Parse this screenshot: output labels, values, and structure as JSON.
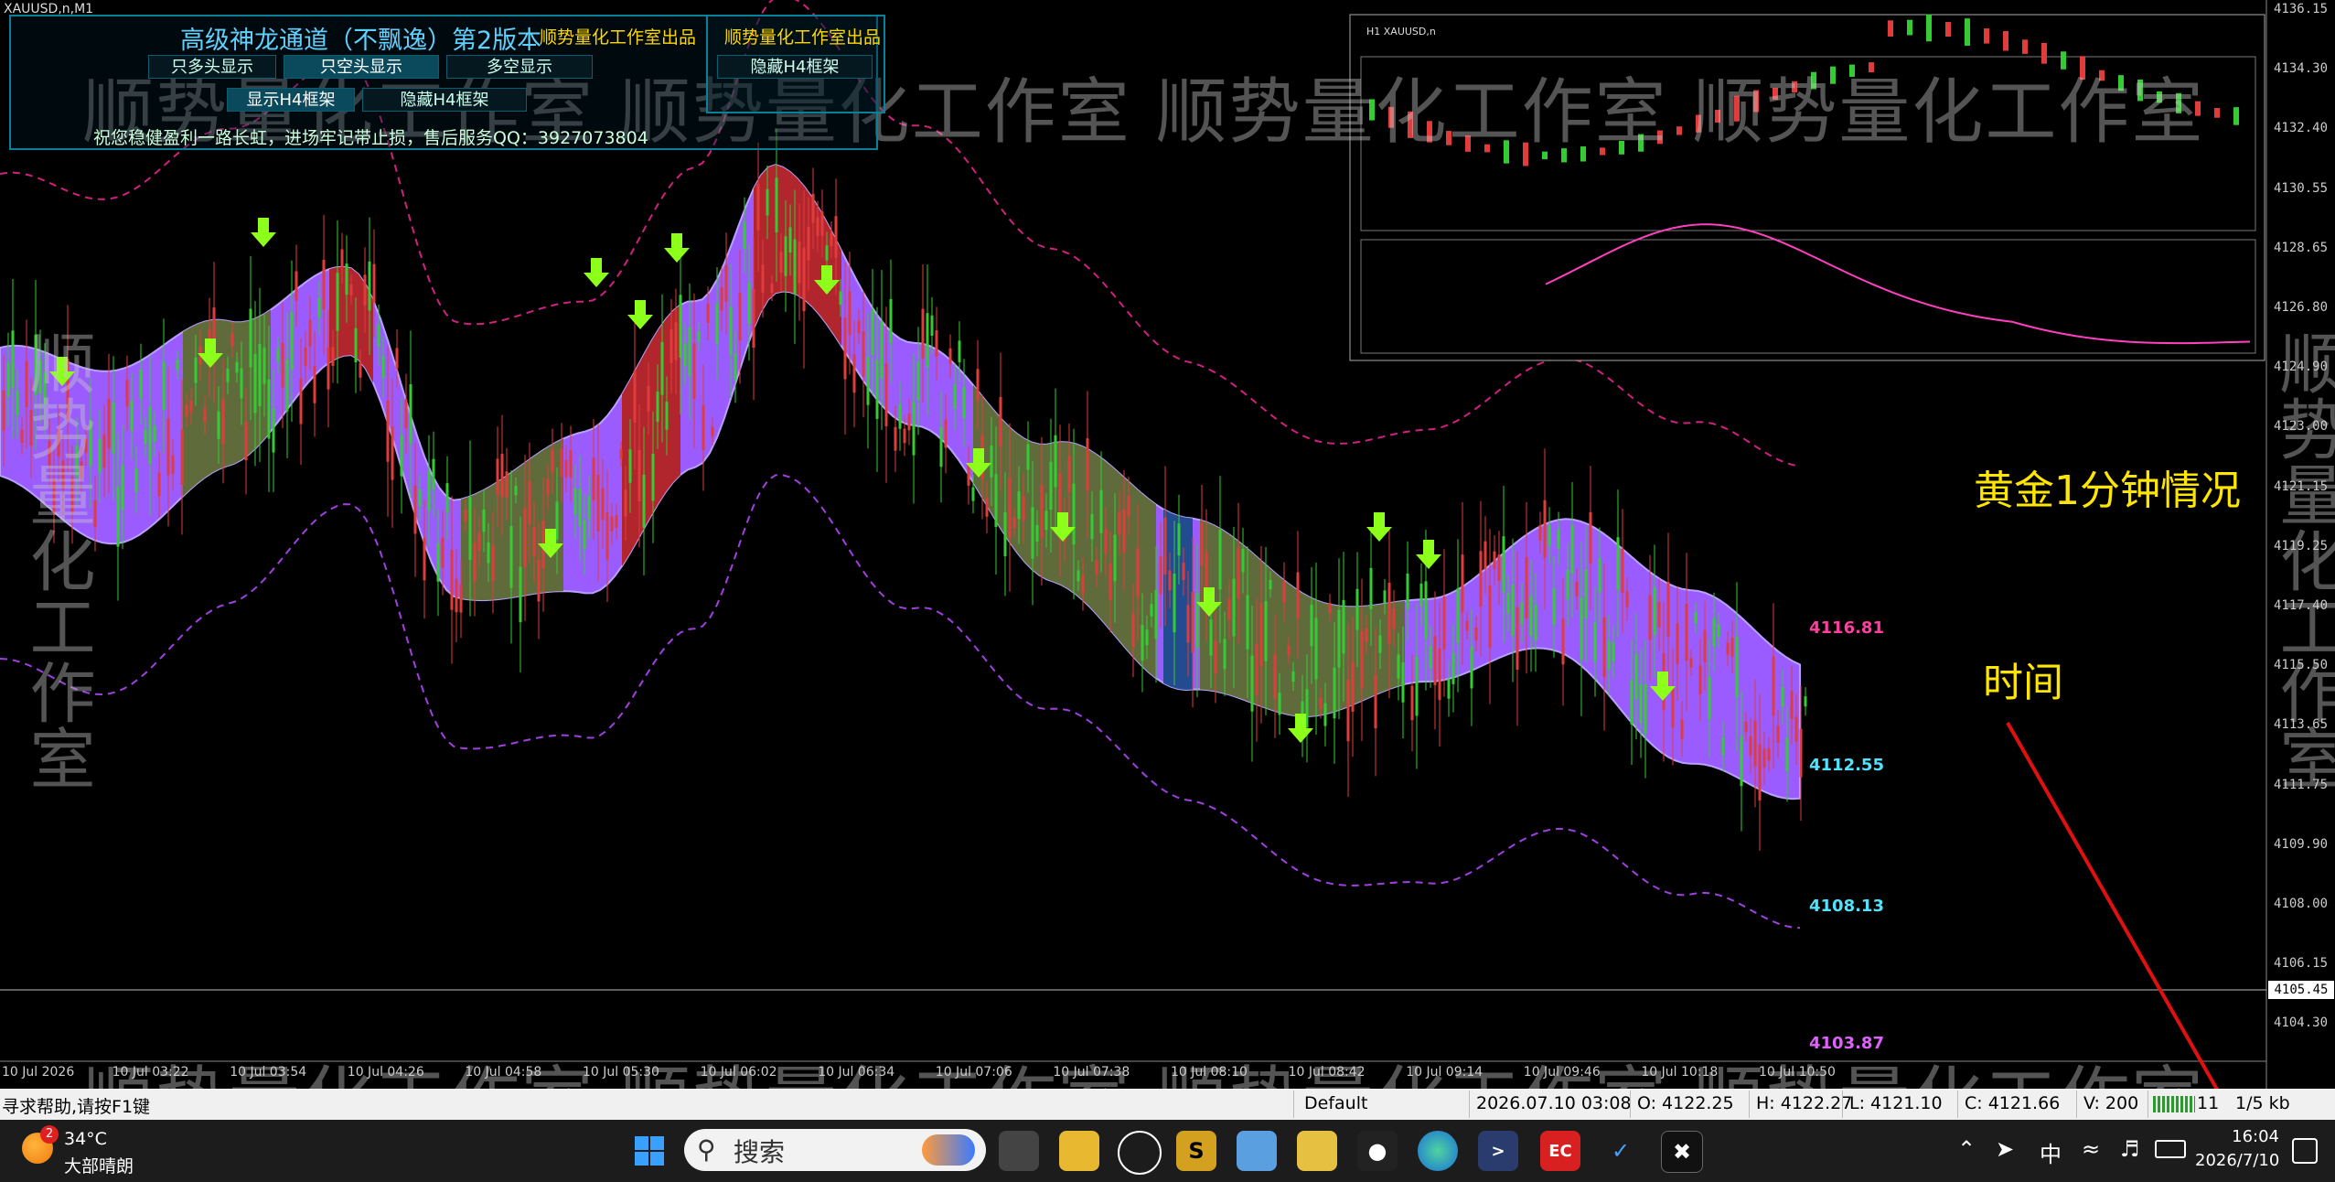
{
  "window": {
    "symbol_label": "XAUUSD,n,M1"
  },
  "panel": {
    "title": "高级神龙通道（不飘逸）第2版本",
    "credit": "顺势量化工作室出品",
    "credit2": "顺势量化工作室出品",
    "btn_long": "只多头显示",
    "btn_short": "只空头显示",
    "btn_multi": "多空显示",
    "btn_hide_h4_top": "隐藏H4框架",
    "btn_show_h4": "显示H4框架",
    "btn_hide_h4": "隐藏H4框架",
    "message": "祝您稳健盈利一路长虹，进场牢记带止损，售后服务QQ：3927073804"
  },
  "watermark": {
    "text": "顺势量化工作室 顺势量化工作室 顺势量化工作室 顺势量化工作室",
    "side": "顺势量化工作室"
  },
  "mini_chart": {
    "label": "H1  XAUUSD,n"
  },
  "y_axis": [
    "4136.15",
    "4134.30",
    "4132.40",
    "4130.55",
    "4128.65",
    "4126.80",
    "4124.90",
    "4123.00",
    "4121.15",
    "4119.25",
    "4117.40",
    "4115.50",
    "4113.65",
    "4111.75",
    "4109.90",
    "4108.00",
    "4106.15",
    "4104.30"
  ],
  "current_price": "4105.45",
  "x_axis": [
    "10 Jul 2026",
    "10 Jul 03:22",
    "10 Jul 03:54",
    "10 Jul 04:26",
    "10 Jul 04:58",
    "10 Jul 05:30",
    "10 Jul 06:02",
    "10 Jul 06:34",
    "10 Jul 07:06",
    "10 Jul 07:38",
    "10 Jul 08:10",
    "10 Jul 08:42",
    "10 Jul 09:14",
    "10 Jul 09:46",
    "10 Jul 10:18",
    "10 Jul 10:50"
  ],
  "levels": {
    "top": "4116.81",
    "upper": "4112.55",
    "lower": "4108.13",
    "bottom": "4103.87"
  },
  "annotations": {
    "gold": "黄金1分钟情况",
    "time": "时间"
  },
  "status_bar": {
    "help": "寻求帮助,请按F1键",
    "profile": "Default",
    "datetime": "2026.07.10 03:08",
    "open": "O: 4122.25",
    "high": "H: 4122.27",
    "low": "L: 4121.10",
    "close": "C: 4121.66",
    "volume": "V: 200",
    "traffic": "11",
    "speed": "1/5 kb"
  },
  "taskbar": {
    "weather_temp": "34°C",
    "weather_desc": "大部晴朗",
    "weather_badge": "2",
    "search_label": "搜索",
    "lang": "中",
    "time": "16:04",
    "date": "2026/7/10"
  },
  "colors": {
    "band_purple": "#9a5cff",
    "band_red": "#b22222",
    "band_olive": "#5c6b30",
    "band_blue": "#1c4a8a",
    "arrow": "#8cff1a",
    "up_candle": "#33cc33",
    "down_candle": "#e03c3c"
  }
}
